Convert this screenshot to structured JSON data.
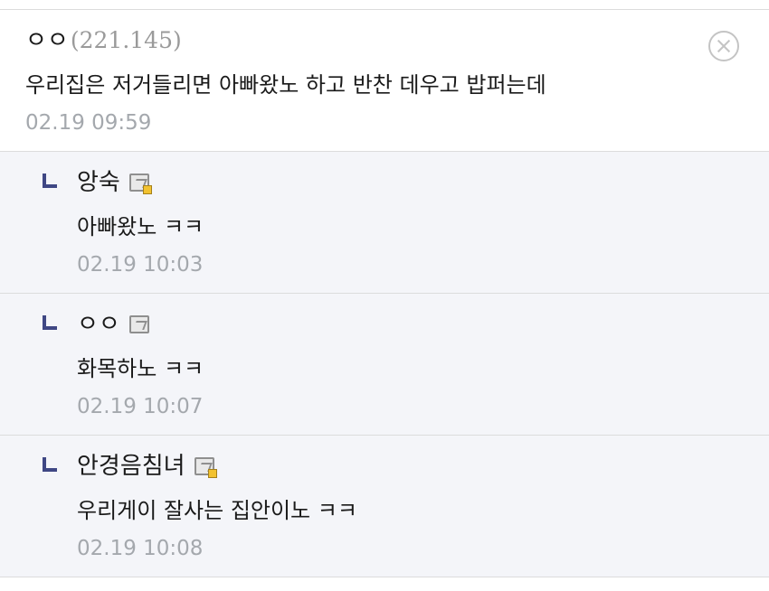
{
  "comment": {
    "nickname": "ㅇㅇ",
    "ip": "(221.145)",
    "text": "우리집은 저거들리면 아빠왔노 하고 반찬 데우고 밥퍼는데",
    "timestamp": "02.19 09:59"
  },
  "replies": [
    {
      "nickname": "앙숙",
      "text": "아빠왔노 ㅋㅋ",
      "timestamp": "02.19 10:03",
      "member_icon": "fixed-nick-icon"
    },
    {
      "nickname": "ㅇㅇ",
      "text": "화목하노 ㅋㅋ",
      "timestamp": "02.19 10:07",
      "member_icon": "semi-fixed-nick-icon"
    },
    {
      "nickname": "안경음침녀",
      "text": "우리게이 잘사는 집안이노 ㅋㅋ",
      "timestamp": "02.19 10:08",
      "member_icon": "fixed-nick-icon"
    }
  ],
  "icons": {
    "delete": "close-circle-icon",
    "reply": "reply-arrow-icon"
  },
  "colors": {
    "reply_background": "#f4f5f9",
    "reply_arrow": "#3f4784",
    "timestamp": "#a4a8ad",
    "ip": "#9a9a9a",
    "member_badge": "#f2c230"
  }
}
